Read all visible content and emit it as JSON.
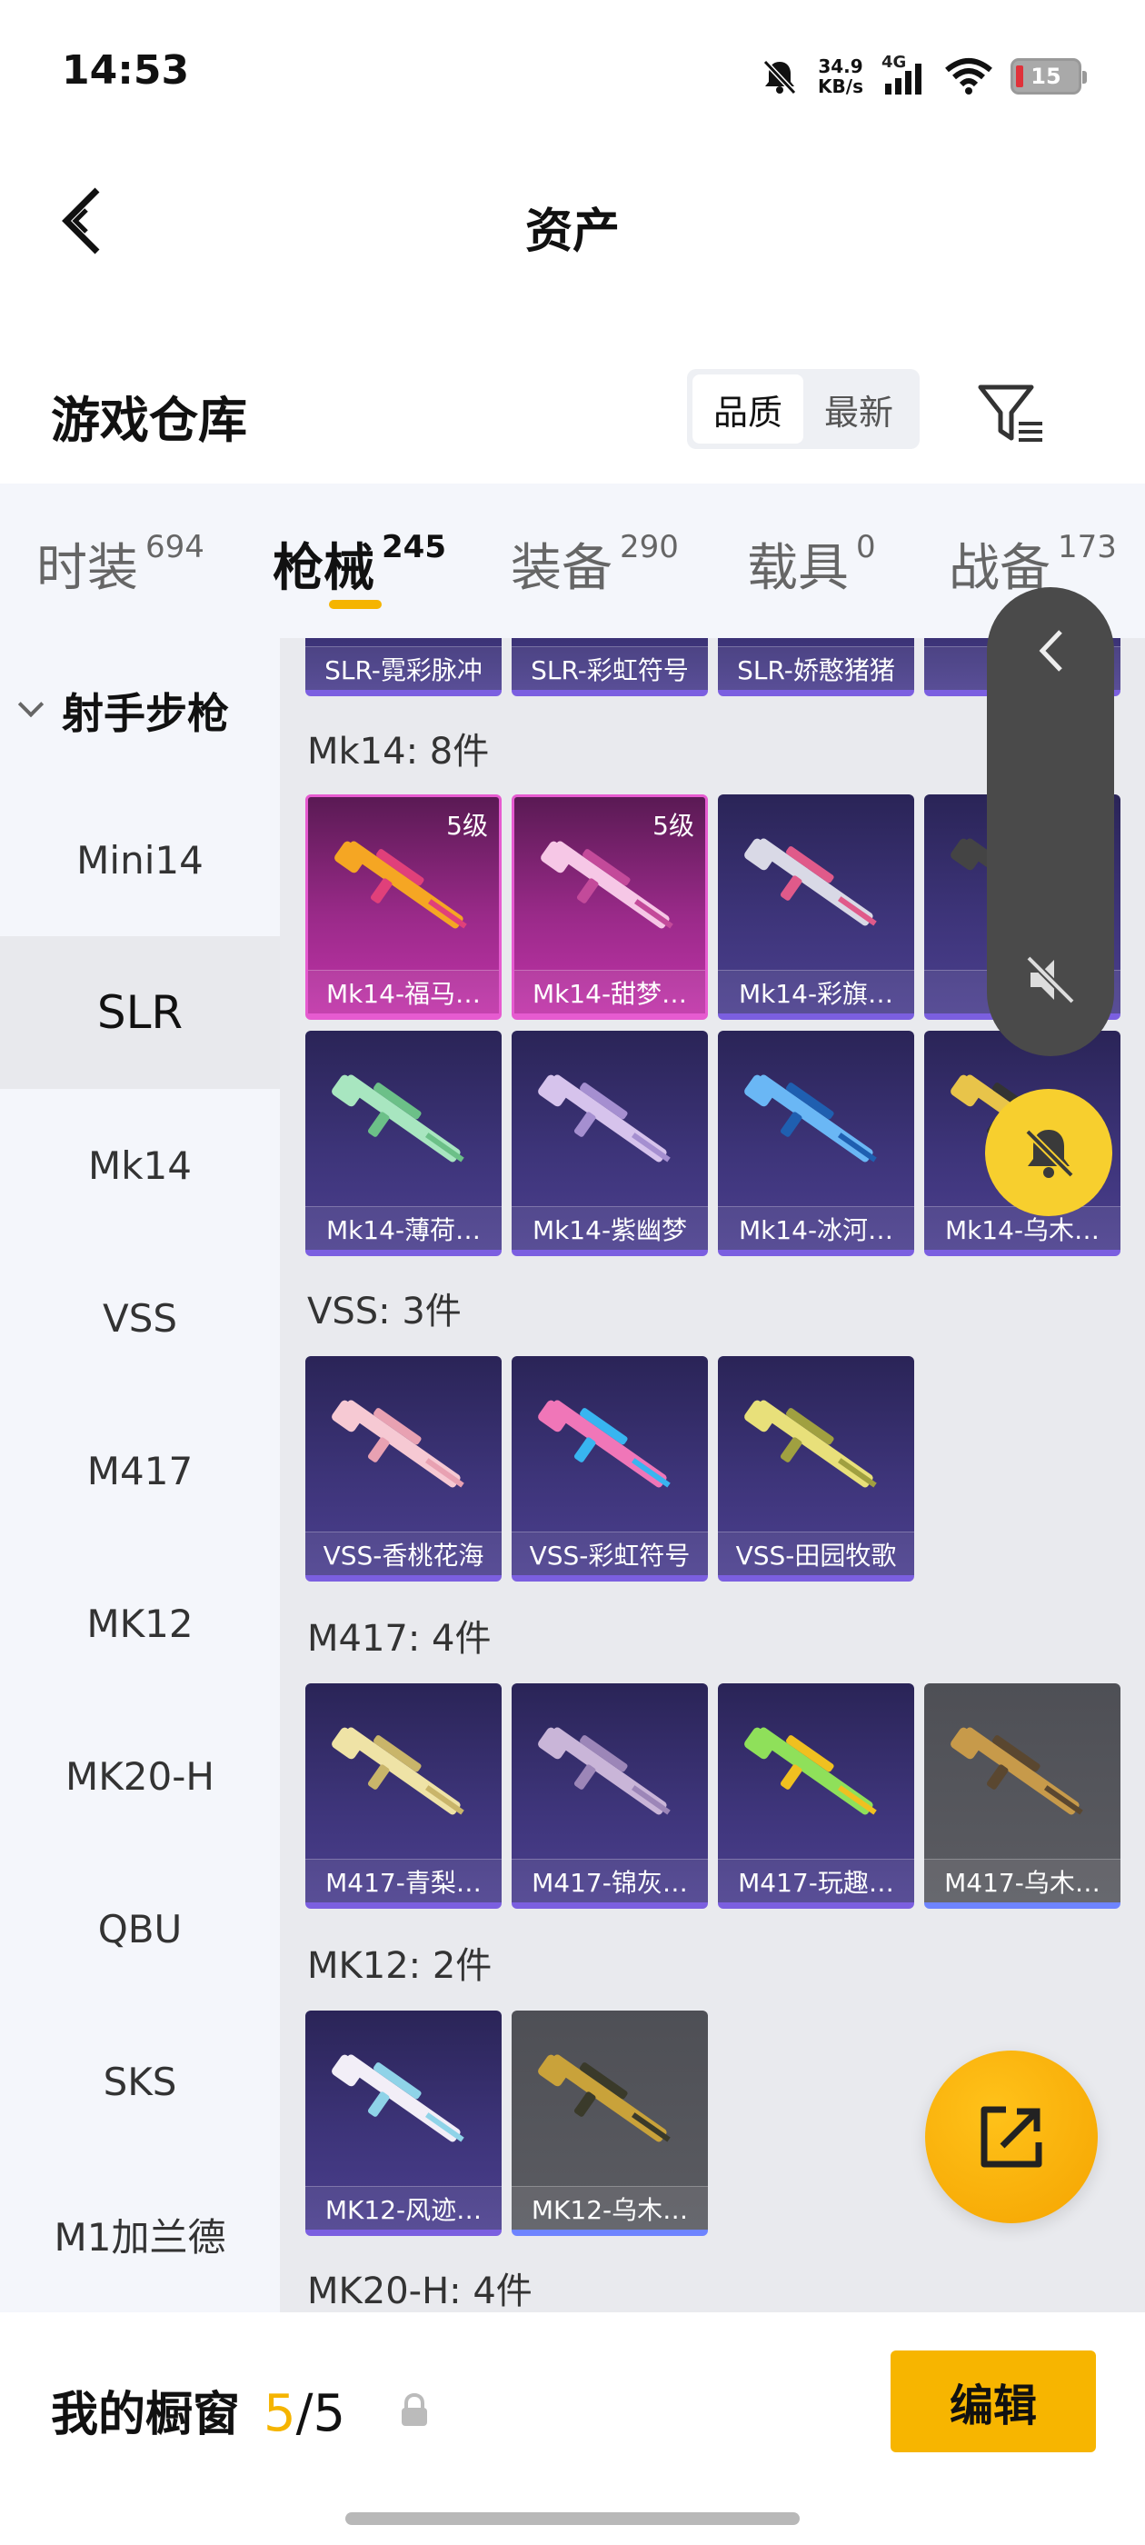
{
  "status_bar": {
    "time": "14:53",
    "speed_value": "34.9",
    "speed_unit": "KB/s",
    "network": "4G",
    "battery": "15"
  },
  "header": {
    "title": "资产"
  },
  "warehouse": {
    "title": "游戏仓库",
    "sort_options": [
      "品质",
      "最新"
    ],
    "active_sort": "品质"
  },
  "tabs": [
    {
      "label": "时装",
      "count": "694",
      "active": false
    },
    {
      "label": "枪械",
      "count": "245",
      "active": true
    },
    {
      "label": "装备",
      "count": "290",
      "active": false
    },
    {
      "label": "载具",
      "count": "0",
      "active": false
    },
    {
      "label": "战备",
      "count": "173",
      "active": false
    }
  ],
  "sidebar": {
    "group": "射手步枪",
    "items": [
      "Mini14",
      "SLR",
      "Mk14",
      "VSS",
      "M417",
      "MK12",
      "MK20-H",
      "QBU",
      "SKS",
      "M1加兰德"
    ],
    "active": "SLR"
  },
  "sections": [
    {
      "title": "",
      "items": [
        {
          "name": "SLR-霓彩脉冲",
          "rarity": "epic"
        },
        {
          "name": "SLR-彩虹符号",
          "rarity": "epic"
        },
        {
          "name": "SLR-娇憨猪猪",
          "rarity": "epic"
        },
        {
          "name": "SLR",
          "rarity": "epic"
        }
      ]
    },
    {
      "title": "Mk14: 8件",
      "items": [
        {
          "name": "Mk14-福马…",
          "rarity": "legend",
          "level": "5级"
        },
        {
          "name": "Mk14-甜梦…",
          "rarity": "legend",
          "level": "5级"
        },
        {
          "name": "Mk14-彩旗…",
          "rarity": "epic"
        },
        {
          "name": "Mk",
          "rarity": "epic"
        },
        {
          "name": "Mk14-薄荷…",
          "rarity": "epic"
        },
        {
          "name": "Mk14-紫幽梦",
          "rarity": "epic"
        },
        {
          "name": "Mk14-冰河…",
          "rarity": "epic"
        },
        {
          "name": "Mk14-乌木…",
          "rarity": "epic"
        }
      ]
    },
    {
      "title": "VSS: 3件",
      "items": [
        {
          "name": "VSS-香桃花海",
          "rarity": "epic"
        },
        {
          "name": "VSS-彩虹符号",
          "rarity": "epic"
        },
        {
          "name": "VSS-田园牧歌",
          "rarity": "epic"
        }
      ]
    },
    {
      "title": "M417: 4件",
      "items": [
        {
          "name": "M417-青梨…",
          "rarity": "epic"
        },
        {
          "name": "M417-锦灰…",
          "rarity": "epic"
        },
        {
          "name": "M417-玩趣…",
          "rarity": "epic"
        },
        {
          "name": "M417-乌木…",
          "rarity": "grey"
        }
      ]
    },
    {
      "title": "MK12: 2件",
      "items": [
        {
          "name": "MK12-风迹…",
          "rarity": "epic"
        },
        {
          "name": "MK12-乌木…",
          "rarity": "grey"
        }
      ]
    },
    {
      "title": "MK20-H: 4件",
      "items": []
    }
  ],
  "weapon_colors": [
    [
      "#f5a623",
      "#e0407a"
    ],
    [
      "#f6c7e6",
      "#c34a9a"
    ],
    [
      "#d9d9e6",
      "#e05a8a"
    ],
    [
      "#444444",
      "#888888"
    ],
    [
      "#a8e6c0",
      "#6cc088"
    ],
    [
      "#d6c3ec",
      "#a58fd0"
    ],
    [
      "#6ab7f5",
      "#1f5fb0"
    ],
    [
      "#e8c44a",
      "#333333"
    ],
    [
      "#f6c9d3",
      "#e8a1b2"
    ],
    [
      "#f076b8",
      "#38b5f0"
    ],
    [
      "#e8e07a",
      "#a0a040"
    ],
    [
      "#efe3a6",
      "#c9b56a"
    ],
    [
      "#c9b5d8",
      "#9c86b8"
    ],
    [
      "#8fe05a",
      "#f0c020"
    ],
    [
      "#c79a4a",
      "#5a4730"
    ],
    [
      "#f2eef7",
      "#8fd3e8"
    ],
    [
      "#c9a23a",
      "#3a3a2a"
    ]
  ],
  "showcase": {
    "label": "我的橱窗",
    "used": "5",
    "separator": "/",
    "total": "5"
  },
  "edit_label": "编辑"
}
